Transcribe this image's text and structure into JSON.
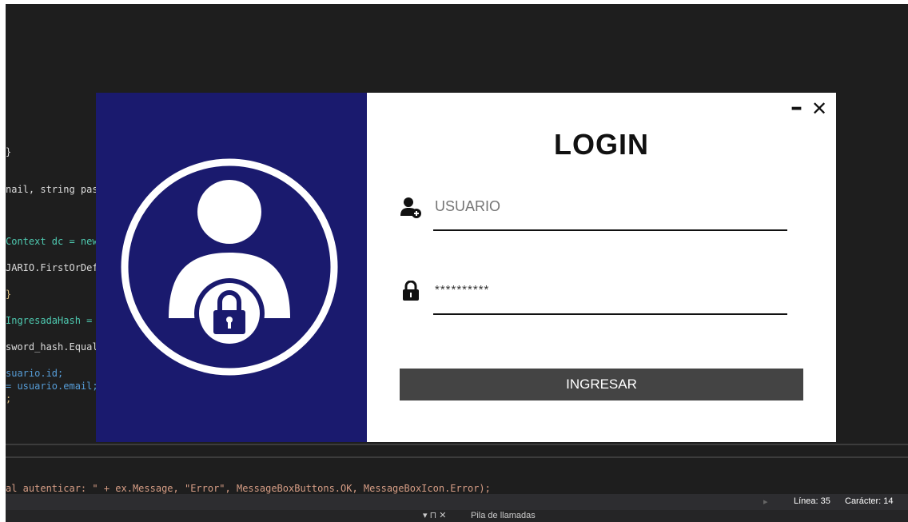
{
  "ide": {
    "code_lines": [
      "}",
      "nail, string pass",
      "Context dc = new",
      "JARIO.FirstOrDefa",
      "}",
      "IngresadaHash = (",
      "sword_hash.Equals",
      "suario.id;",
      "= usuario.email;",
      ";",
      "al autenticar: \" + ex.Message, \"Error\", MessageBoxButtons.OK, MessageBoxIcon.Error);"
    ],
    "status": {
      "line_label": "Línea: 35",
      "char_label": "Carácter: 14"
    },
    "bottom_panel_label": "Pila de llamadas",
    "bottom_panel_controls": "▾ ⊓ ✕"
  },
  "login": {
    "title": "LOGIN",
    "minimize_glyph": "–",
    "close_glyph": "✕",
    "username": {
      "placeholder": "USUARIO",
      "value": "USUARIO"
    },
    "password": {
      "value": "**********"
    },
    "submit_label": "INGRESAR",
    "colors": {
      "left_panel": "#1a1a6e",
      "button": "#444444",
      "ide_background": "#1e1e1e"
    },
    "icons": {
      "avatar": "user-lock-icon",
      "user_field": "user-add-icon",
      "password_field": "lock-icon"
    }
  }
}
